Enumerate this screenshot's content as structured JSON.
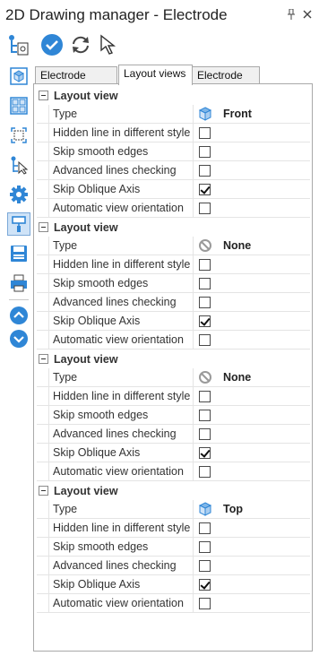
{
  "window": {
    "title": "2D Drawing manager - Electrode"
  },
  "titlebar_icons": [
    "pin-icon",
    "close-icon"
  ],
  "toolbar": {
    "items": [
      {
        "name": "tree-settings-icon"
      },
      {
        "name": "confirm-icon"
      },
      {
        "name": "refresh-icon"
      },
      {
        "name": "cursor-icon"
      }
    ]
  },
  "sidebar": {
    "items": [
      {
        "name": "cube-view-icon",
        "active": false
      },
      {
        "name": "layout-grid-icon",
        "active": false
      },
      {
        "name": "crop-frame-icon",
        "active": false
      },
      {
        "name": "tree-cursor-icon",
        "active": false
      },
      {
        "name": "gear-icon",
        "active": false
      },
      {
        "name": "brush-icon",
        "active": true
      },
      {
        "name": "save-icon",
        "active": false
      },
      {
        "name": "print-icon",
        "active": false
      },
      {
        "name": "chevron-up-circle-icon",
        "active": false
      },
      {
        "name": "chevron-down-circle-icon",
        "active": false
      }
    ]
  },
  "tabs": [
    {
      "label": "Electrode views",
      "active": false
    },
    {
      "label": "Layout views",
      "active": true
    },
    {
      "label": "Electrode list",
      "active": false
    }
  ],
  "colors": {
    "accent": "#2f86d6",
    "selected_bg": "#cfe3f7",
    "border": "#a9a9a9"
  },
  "sections": [
    {
      "label": "Layout view",
      "type_label": "Type",
      "type_value": "Front",
      "type_icon": "cube-icon",
      "props": [
        {
          "label": "Hidden line in different style",
          "checked": false
        },
        {
          "label": "Skip smooth edges",
          "checked": false
        },
        {
          "label": "Advanced lines checking",
          "checked": false
        },
        {
          "label": "Skip Oblique Axis",
          "checked": true
        },
        {
          "label": "Automatic view orientation",
          "checked": false
        }
      ]
    },
    {
      "label": "Layout view",
      "type_label": "Type",
      "type_value": "None",
      "type_icon": "none-icon",
      "props": [
        {
          "label": "Hidden line in different style",
          "checked": false
        },
        {
          "label": "Skip smooth edges",
          "checked": false
        },
        {
          "label": "Advanced lines checking",
          "checked": false
        },
        {
          "label": "Skip Oblique Axis",
          "checked": true
        },
        {
          "label": "Automatic view orientation",
          "checked": false
        }
      ]
    },
    {
      "label": "Layout view",
      "type_label": "Type",
      "type_value": "None",
      "type_icon": "none-icon",
      "props": [
        {
          "label": "Hidden line in different style",
          "checked": false
        },
        {
          "label": "Skip smooth edges",
          "checked": false
        },
        {
          "label": "Advanced lines checking",
          "checked": false
        },
        {
          "label": "Skip Oblique Axis",
          "checked": true
        },
        {
          "label": "Automatic view orientation",
          "checked": false
        }
      ]
    },
    {
      "label": "Layout view",
      "type_label": "Type",
      "type_value": "Top",
      "type_icon": "cube-icon",
      "props": [
        {
          "label": "Hidden line in different style",
          "checked": false
        },
        {
          "label": "Skip smooth edges",
          "checked": false
        },
        {
          "label": "Advanced lines checking",
          "checked": false
        },
        {
          "label": "Skip Oblique Axis",
          "checked": true
        },
        {
          "label": "Automatic view orientation",
          "checked": false
        }
      ]
    }
  ]
}
